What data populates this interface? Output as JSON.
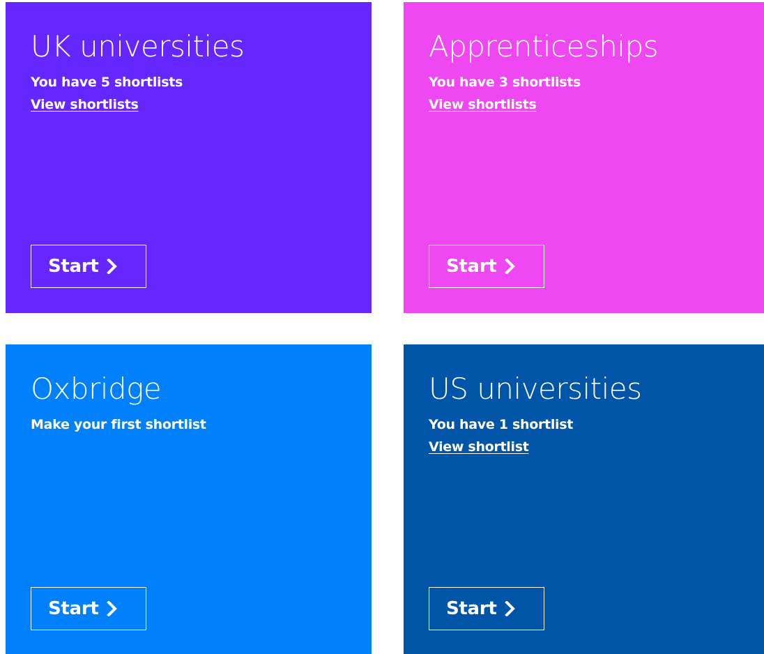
{
  "cards": [
    {
      "title": "UK universities",
      "subtitle": "You have 5 shortlists",
      "link": "View shortlists",
      "button": "Start",
      "color": "#6526FF"
    },
    {
      "title": "Apprenticeships",
      "subtitle": "You have 3 shortlists",
      "link": "View shortlists",
      "button": "Start",
      "color": "#EF47F1"
    },
    {
      "title": "Oxbridge",
      "subtitle": "Make your first shortlist",
      "button": "Start",
      "color": "#0080FA"
    },
    {
      "title": "US universities",
      "subtitle": "You have 1 shortlist",
      "link": "View shortlist",
      "button": "Start",
      "color": "#0055A9"
    }
  ],
  "icons": {
    "button_icon": "chevron-right-icon"
  }
}
